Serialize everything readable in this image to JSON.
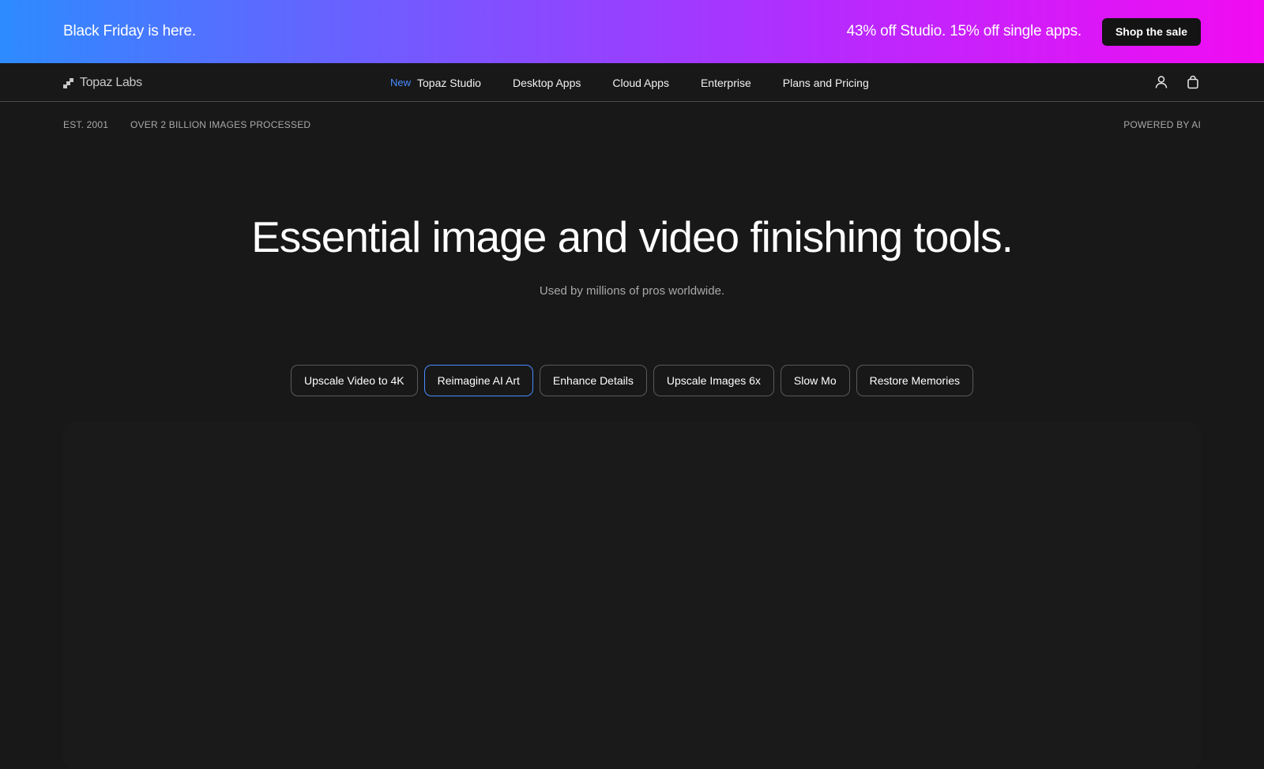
{
  "promo": {
    "headline": "Black Friday is here.",
    "offer": "43% off Studio. 15% off single apps.",
    "cta_label": "Shop the sale"
  },
  "nav": {
    "logo_text": "Topaz Labs",
    "new_badge": "New",
    "items": [
      {
        "label": "Topaz Studio"
      },
      {
        "label": "Desktop Apps"
      },
      {
        "label": "Cloud Apps"
      },
      {
        "label": "Enterprise"
      },
      {
        "label": "Plans and Pricing"
      }
    ],
    "icons": [
      "account-icon",
      "cart-icon"
    ]
  },
  "meta": {
    "established": "EST. 2001",
    "processed": "OVER 2 BILLION IMAGES PROCESSED",
    "powered": "POWERED BY AI"
  },
  "hero": {
    "title": "Essential image and video finishing tools.",
    "subtitle": "Used by millions of pros worldwide."
  },
  "tabs": [
    {
      "label": "Upscale Video to 4K",
      "active": false
    },
    {
      "label": "Reimagine AI Art",
      "active": true
    },
    {
      "label": "Enhance Details",
      "active": false
    },
    {
      "label": "Upscale Images 6x",
      "active": false
    },
    {
      "label": "Slow Mo",
      "active": false
    },
    {
      "label": "Restore Memories",
      "active": false
    }
  ],
  "colors": {
    "accent": "#4a8bff",
    "background": "#181818",
    "promo_gradient_start": "#2d8bff",
    "promo_gradient_end": "#f20bf2"
  }
}
